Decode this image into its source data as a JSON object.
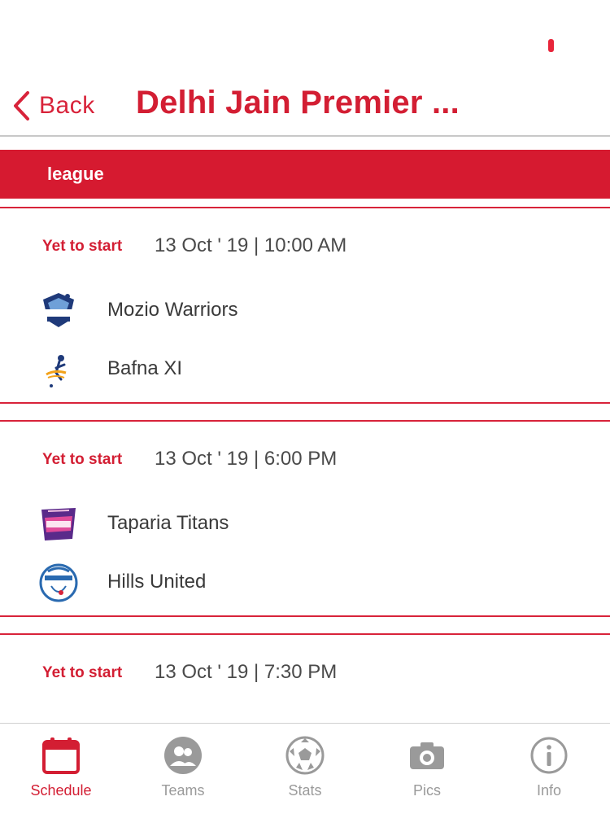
{
  "header": {
    "back_label": "Back",
    "title": "Delhi Jain Premier ..."
  },
  "group_banner": "league",
  "matches": [
    {
      "status": "Yet to start",
      "datetime": "13 Oct ' 19 | 10:00 AM",
      "teams": [
        {
          "name": "Mozio Warriors",
          "logo": "mozio-warriors-logo"
        },
        {
          "name": "Bafna XI",
          "logo": "bafna-xi-logo"
        }
      ]
    },
    {
      "status": "Yet to start",
      "datetime": "13 Oct ' 19 | 6:00 PM",
      "teams": [
        {
          "name": "Taparia Titans",
          "logo": "taparia-titans-logo"
        },
        {
          "name": "Hills United",
          "logo": "hills-united-logo"
        }
      ]
    },
    {
      "status": "Yet to start",
      "datetime": "13 Oct ' 19 | 7:30 PM",
      "teams": []
    }
  ],
  "bottom_nav": [
    {
      "label": "Schedule",
      "icon": "calendar-icon",
      "active": true
    },
    {
      "label": "Teams",
      "icon": "teams-icon",
      "active": false
    },
    {
      "label": "Stats",
      "icon": "soccer-ball-icon",
      "active": false
    },
    {
      "label": "Pics",
      "icon": "camera-icon",
      "active": false
    },
    {
      "label": "Info",
      "icon": "info-icon",
      "active": false
    }
  ],
  "colors": {
    "accent": "#d31e33",
    "banner": "#d61a30",
    "nav_inactive": "#9a9a9a"
  }
}
